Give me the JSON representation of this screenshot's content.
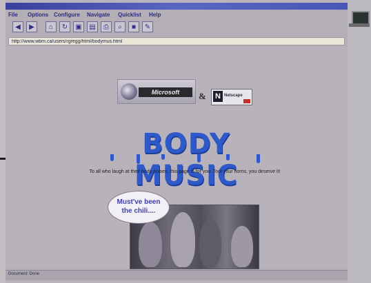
{
  "browser": {
    "menu": [
      "File",
      "Options",
      "Configure",
      "Navigate",
      "Quicklist",
      "Help"
    ],
    "toolbar_icons": [
      "back-arrow-icon",
      "forward-arrow-icon",
      "home-icon",
      "reload-icon",
      "images-icon",
      "open-icon",
      "print-icon",
      "find-icon",
      "stop-icon",
      "edit-icon"
    ],
    "address": "http://www.wbm.ca/users/rgregg/html/bodymus.html",
    "status": "Document: Done"
  },
  "page": {
    "logo_ms_text": "Microsoft",
    "ampersand": "&",
    "logo_ns_letter": "N",
    "logo_ns_text": "Netscape",
    "title": "BODY MUSIC",
    "tagline": "To all who laugh at their body noises, this page is for you. Toot your horns, you deserve it!",
    "bubble_line1": "Must've been",
    "bubble_line2": "the chili....",
    "title_color": "#2f58c8"
  }
}
